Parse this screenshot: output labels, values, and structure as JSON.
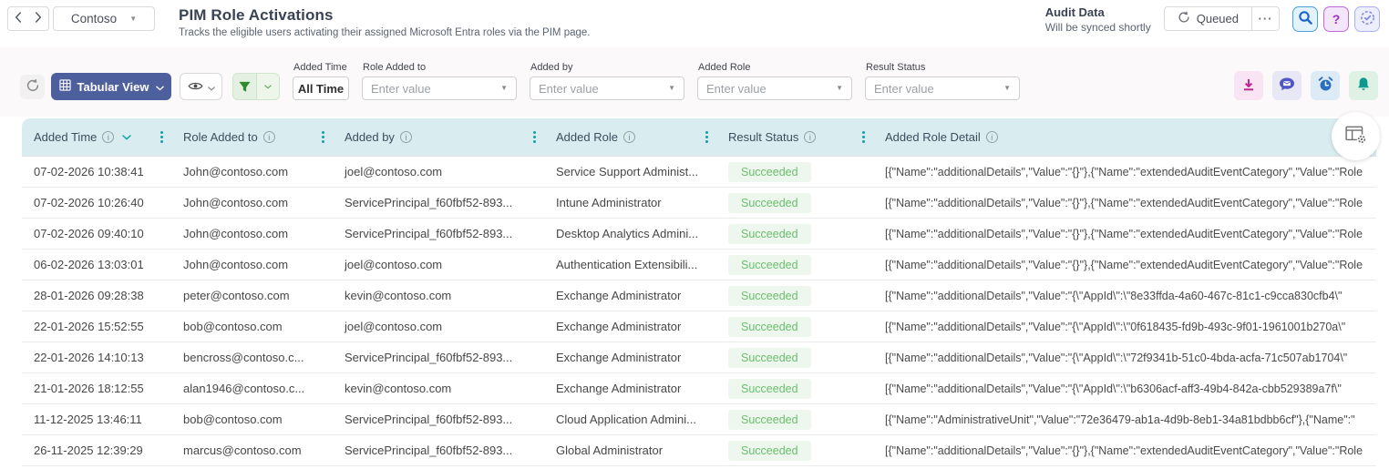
{
  "topbar": {
    "org": "Contoso",
    "title": "PIM Role Activations",
    "subtitle": "Tracks the eligible users activating their assigned Microsoft Entra roles via the PIM page.",
    "audit": {
      "title": "Audit Data",
      "subtitle": "Will be synced shortly"
    },
    "queued_label": "Queued"
  },
  "icons": {
    "caret_down": "▼",
    "more": "···",
    "help": "?",
    "info": "i"
  },
  "toolbar": {
    "view_button": "Tabular View",
    "filters": [
      {
        "label": "Added Time",
        "value": "All Time"
      },
      {
        "label": "Role Added to",
        "placeholder": "Enter value"
      },
      {
        "label": "Added by",
        "placeholder": "Enter value"
      },
      {
        "label": "Added Role",
        "placeholder": "Enter value"
      },
      {
        "label": "Result Status",
        "placeholder": "Enter value"
      }
    ]
  },
  "table": {
    "columns": [
      {
        "label": "Added Time"
      },
      {
        "label": "Role Added to"
      },
      {
        "label": "Added by"
      },
      {
        "label": "Added Role"
      },
      {
        "label": "Result Status"
      },
      {
        "label": "Added Role Detail"
      }
    ],
    "rows": [
      {
        "time": "07-02-2026 10:38:41",
        "role_added_to": "John@contoso.com",
        "added_by": "joel@contoso.com",
        "added_role": "Service Support Administ...",
        "result_status": "Succeeded",
        "detail": "[{\"Name\":\"additionalDetails\",\"Value\":\"{}\"},{\"Name\":\"extendedAuditEventCategory\",\"Value\":\"Role"
      },
      {
        "time": "07-02-2026 10:26:40",
        "role_added_to": "John@contoso.com",
        "added_by": "ServicePrincipal_f60fbf52-893...",
        "added_role": "Intune Administrator",
        "result_status": "Succeeded",
        "detail": "[{\"Name\":\"additionalDetails\",\"Value\":\"{}\"},{\"Name\":\"extendedAuditEventCategory\",\"Value\":\"Role"
      },
      {
        "time": "07-02-2026 09:40:10",
        "role_added_to": "John@contoso.com",
        "added_by": "ServicePrincipal_f60fbf52-893...",
        "added_role": "Desktop Analytics Admini...",
        "result_status": "Succeeded",
        "detail": "[{\"Name\":\"additionalDetails\",\"Value\":\"{}\"},{\"Name\":\"extendedAuditEventCategory\",\"Value\":\"Role"
      },
      {
        "time": "06-02-2026 13:03:01",
        "role_added_to": "John@contoso.com",
        "added_by": "joel@contoso.com",
        "added_role": "Authentication Extensibili...",
        "result_status": "Succeeded",
        "detail": "[{\"Name\":\"additionalDetails\",\"Value\":\"{}\"},{\"Name\":\"extendedAuditEventCategory\",\"Value\":\"Role"
      },
      {
        "time": "28-01-2026 09:28:38",
        "role_added_to": "peter@contoso.com",
        "added_by": "kevin@contoso.com",
        "added_role": "Exchange Administrator",
        "result_status": "Succeeded",
        "detail": "[{\"Name\":\"additionalDetails\",\"Value\":\"{\\\"AppId\\\":\\\"8e33ffda-4a60-467c-81c1-c9cca830cfb4\\\""
      },
      {
        "time": "22-01-2026 15:52:55",
        "role_added_to": "bob@contoso.com",
        "added_by": "joel@contoso.com",
        "added_role": "Exchange Administrator",
        "result_status": "Succeeded",
        "detail": "[{\"Name\":\"additionalDetails\",\"Value\":\"{\\\"AppId\\\":\\\"0f618435-fd9b-493c-9f01-1961001b270a\\\""
      },
      {
        "time": "22-01-2026 14:10:13",
        "role_added_to": "bencross@contoso.c...",
        "added_by": "ServicePrincipal_f60fbf52-893...",
        "added_role": "Exchange Administrator",
        "result_status": "Succeeded",
        "detail": "[{\"Name\":\"additionalDetails\",\"Value\":\"{\\\"AppId\\\":\\\"72f9341b-51c0-4bda-acfa-71c507ab1704\\\""
      },
      {
        "time": "21-01-2026 18:12:55",
        "role_added_to": "alan1946@contoso.c...",
        "added_by": "kevin@contoso.com",
        "added_role": "Exchange Administrator",
        "result_status": "Succeeded",
        "detail": "[{\"Name\":\"additionalDetails\",\"Value\":\"{\\\"AppId\\\":\\\"b6306acf-aff3-49b4-842a-cbb529389a7f\\\""
      },
      {
        "time": "11-12-2025 13:46:11",
        "role_added_to": "bob@contoso.com",
        "added_by": "ServicePrincipal_f60fbf52-893...",
        "added_role": "Cloud Application Admini...",
        "result_status": "Succeeded",
        "detail": "[{\"Name\":\"AdministrativeUnit\",\"Value\":\"72e36479-ab1a-4d9b-8eb1-34a81bdbb6cf\"},{\"Name\":\""
      },
      {
        "time": "26-11-2025 12:39:29",
        "role_added_to": "marcus@contoso.com",
        "added_by": "ServicePrincipal_f60fbf52-893...",
        "added_role": "Global Administrator",
        "result_status": "Succeeded",
        "detail": "[{\"Name\":\"additionalDetails\",\"Value\":\"{}\"},{\"Name\":\"extendedAuditEventCategory\",\"Value\":\"Role"
      }
    ]
  },
  "colors": {
    "accent": "#4e5f9d",
    "header_bg": "#d9edf0",
    "header_text": "#3d4c5e",
    "teal": "#0fa0aa",
    "filter_green": "#2e8b2e",
    "filter_green_bg": "#e4f1e2",
    "success_text": "#6abf6e",
    "success_bg": "#edf7ed",
    "download_pink": "#c0268f",
    "download_pink_bg": "#f8e4f2",
    "chat_indigo": "#5056c5",
    "chat_indigo_bg": "#e7e7f6",
    "alarm_blue": "#2a6fc0",
    "alarm_blue_bg": "#ddebf7",
    "bell_teal": "#0b9a8d",
    "bell_teal_bg": "#def1e4",
    "search_blue": "#1b66c9",
    "help_purple": "#a02fc4"
  }
}
